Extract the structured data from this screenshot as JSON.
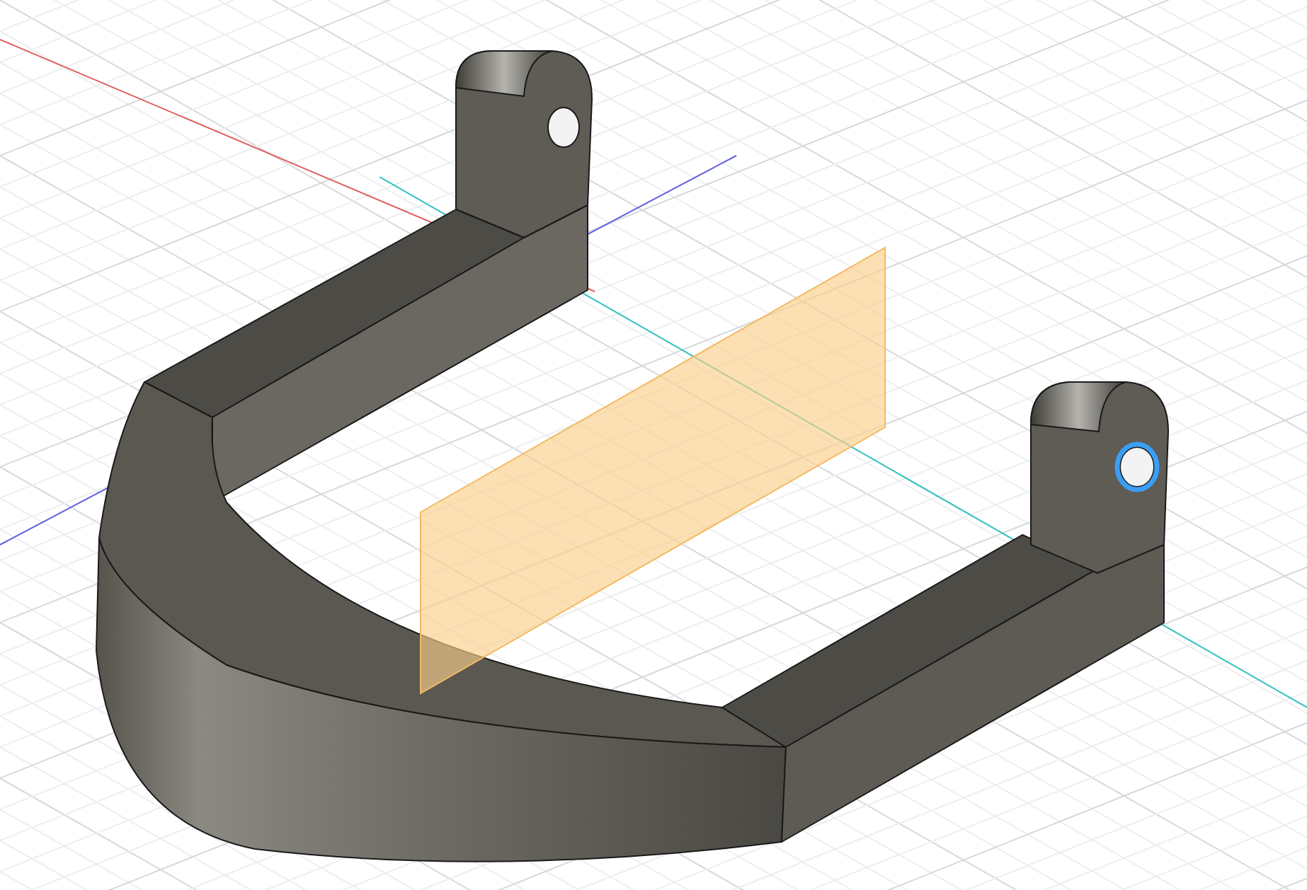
{
  "viewport": {
    "sketch_plane_visible": true,
    "hole_edge_selected": true
  }
}
